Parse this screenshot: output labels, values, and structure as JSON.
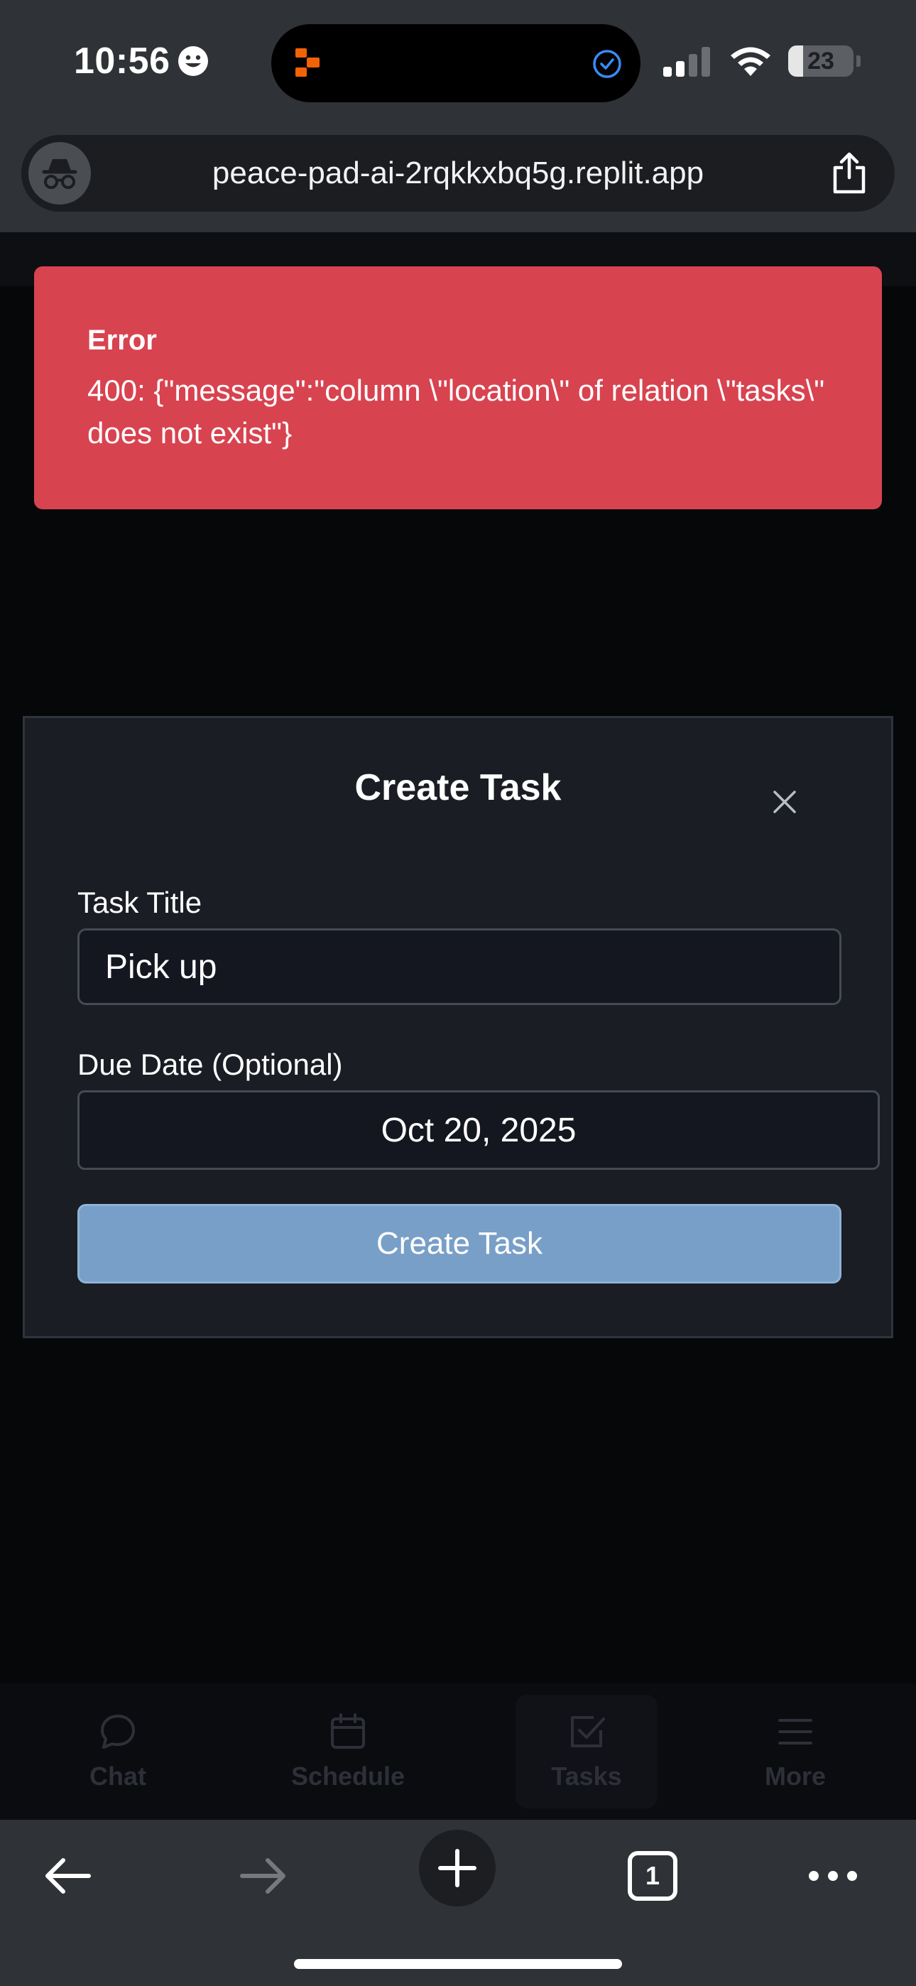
{
  "status_bar": {
    "time": "10:56",
    "battery_level": "23",
    "battery_fraction": 0.23
  },
  "browser": {
    "url": "peace-pad-ai-2rqkkxbq5g.replit.app",
    "tab_count": "1"
  },
  "error_toast": {
    "title": "Error",
    "message": "400: {\"message\":\"column \\\"location\\\" of relation \\\"tasks\\\" does not exist\"}",
    "color": "#d84350"
  },
  "modal": {
    "title": "Create Task",
    "task_title_label": "Task Title",
    "task_title_value": "Pick up",
    "due_date_label": "Due Date (Optional)",
    "due_date_value": "Oct 20, 2025",
    "submit_label": "Create Task",
    "accent": "#789fc7"
  },
  "app_nav": {
    "items": [
      {
        "label": "Chat",
        "icon": "chat-bubble-icon"
      },
      {
        "label": "Schedule",
        "icon": "calendar-icon"
      },
      {
        "label": "Tasks",
        "icon": "check-square-icon"
      },
      {
        "label": "More",
        "icon": "menu-icon"
      }
    ],
    "active": "Tasks"
  },
  "icons": {
    "status": [
      "smiley-icon",
      "signal-icon",
      "wifi-icon",
      "battery-icon"
    ],
    "island": [
      "replit-logo-icon",
      "check-circle-icon"
    ],
    "url_bar": [
      "incognito-icon",
      "share-icon"
    ],
    "toolbar": [
      "back-arrow-icon",
      "forward-arrow-icon",
      "plus-icon",
      "tabs-icon",
      "more-dots-icon"
    ]
  }
}
